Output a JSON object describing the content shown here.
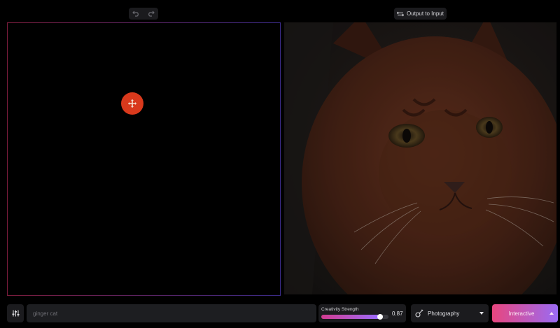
{
  "header": {
    "undo_icon": "undo-icon",
    "redo_icon": "redo-icon",
    "swap_label": "Output to Input",
    "swap_icon": "swap-arrows-icon"
  },
  "canvas": {
    "tool_icon": "crosshair-move-icon",
    "brush_color": "#d9391c"
  },
  "output": {
    "subject": "ginger cat photo"
  },
  "prompt": {
    "value": "",
    "placeholder": "ginger cat"
  },
  "settings": {
    "icon": "sliders-icon"
  },
  "strength": {
    "label": "Creativity Strength",
    "value": "0.87",
    "fraction": 0.87
  },
  "style": {
    "label": "Photography",
    "icon": "guitar-icon"
  },
  "mode": {
    "label": "Interactive"
  },
  "colors": {
    "accent_start": "#e8467e",
    "accent_end": "#9a6bf3",
    "brush": "#d9391c"
  }
}
